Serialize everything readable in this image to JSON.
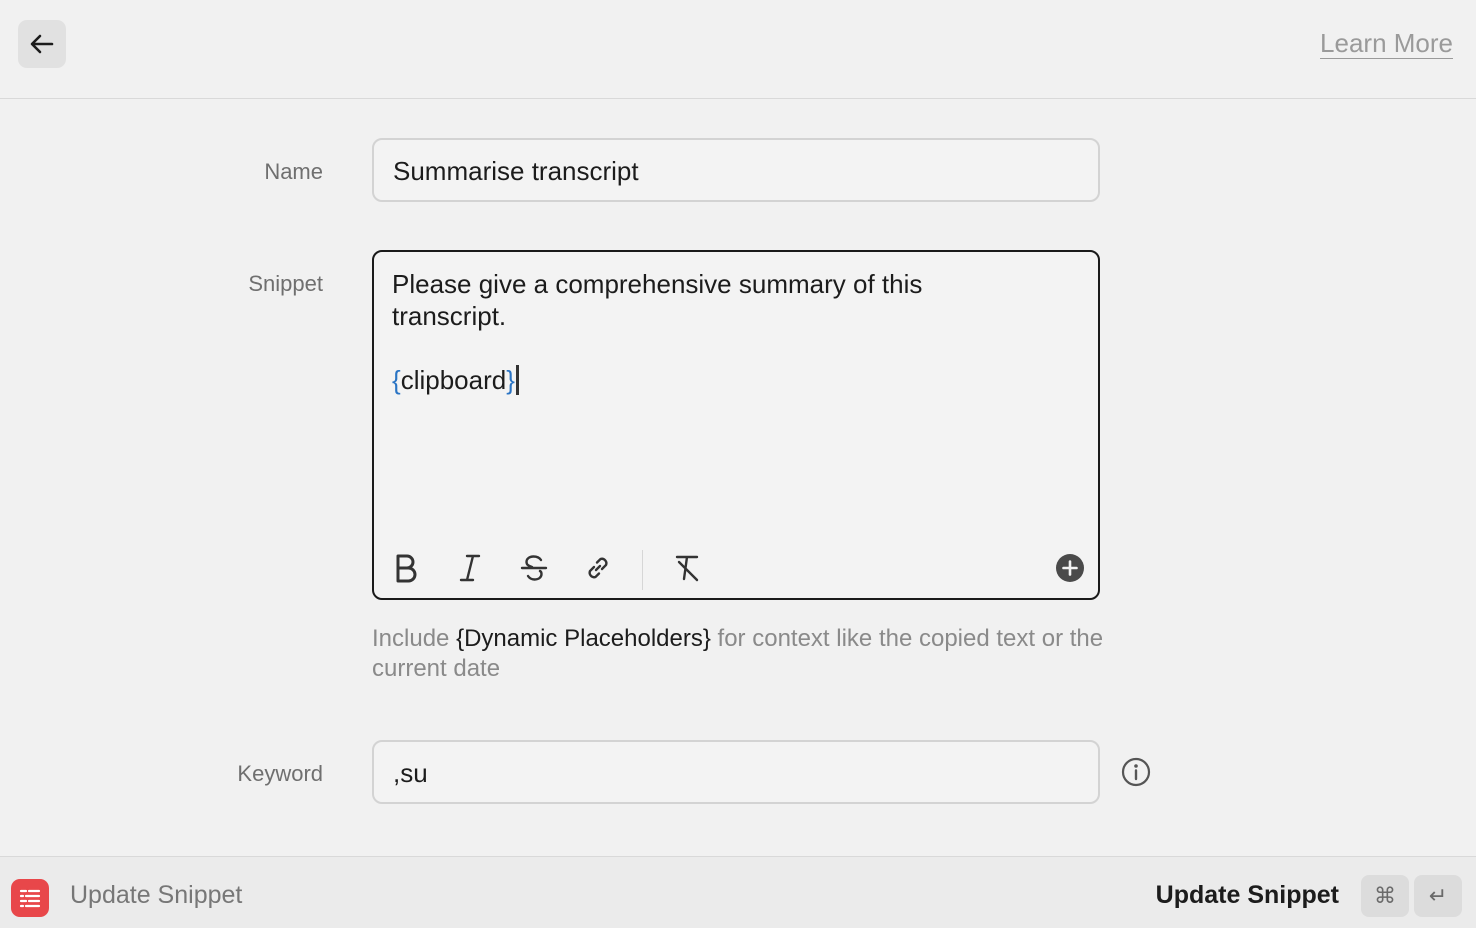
{
  "header": {
    "back_icon": "arrow-left-icon",
    "learn_more": "Learn More"
  },
  "form": {
    "name_label": "Name",
    "name_value": "Summarise transcript",
    "snippet_label": "Snippet",
    "snippet_line1": "Please give a comprehensive summary of this",
    "snippet_line2": "transcript.",
    "snippet_ph_open": "{",
    "snippet_ph_name": "clipboard",
    "snippet_ph_close": "}",
    "toolbar_icons": [
      "bold-icon",
      "italic-icon",
      "strikethrough-icon",
      "link-icon",
      "clear-format-icon",
      "add-placeholder-icon"
    ],
    "hint_prefix": "Include ",
    "hint_strong": "{Dynamic Placeholders}",
    "hint_suffix": " for context like the copied text or the current date",
    "keyword_label": "Keyword",
    "keyword_value": ",su",
    "info_icon": "info-icon"
  },
  "footer": {
    "app_icon": "snippets-icon",
    "title": "Update Snippet",
    "action_label": "Update Snippet",
    "shortcut_cmd": "⌘",
    "shortcut_enter": "↵"
  },
  "colors": {
    "background": "#f1f1f1",
    "placeholder_brace": "#2a74c4",
    "app_icon": "#e8474a"
  }
}
